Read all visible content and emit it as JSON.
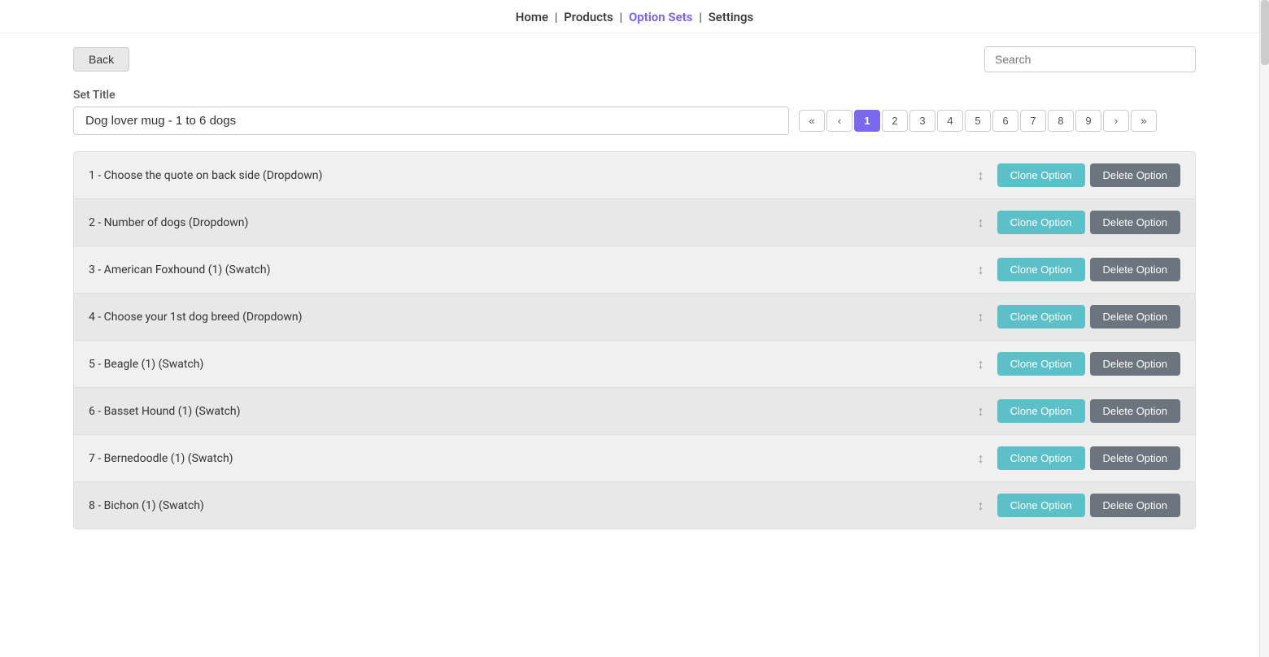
{
  "nav": {
    "home_label": "Home",
    "products_label": "Products",
    "option_sets_label": "Option Sets",
    "settings_label": "Settings",
    "active": "option_sets"
  },
  "toolbar": {
    "back_label": "Back",
    "search_placeholder": "Search"
  },
  "set_title": {
    "label": "Set Title",
    "value": "Dog lover mug - 1 to 6 dogs"
  },
  "pagination": {
    "first": "«",
    "prev": "‹",
    "next": "›",
    "last": "»",
    "pages": [
      "1",
      "2",
      "3",
      "4",
      "5",
      "6",
      "7",
      "8",
      "9"
    ],
    "active_page": "1"
  },
  "options": [
    {
      "id": 1,
      "label": "1 - Choose the quote on back side (Dropdown)"
    },
    {
      "id": 2,
      "label": "2 - Number of dogs (Dropdown)"
    },
    {
      "id": 3,
      "label": "3 - American Foxhound (1) (Swatch)"
    },
    {
      "id": 4,
      "label": "4 - Choose your 1st dog breed (Dropdown)"
    },
    {
      "id": 5,
      "label": "5 - Beagle (1) (Swatch)"
    },
    {
      "id": 6,
      "label": "6 - Basset Hound (1) (Swatch)"
    },
    {
      "id": 7,
      "label": "7 - Bernedoodle (1) (Swatch)"
    },
    {
      "id": 8,
      "label": "8 - Bichon (1) (Swatch)"
    }
  ],
  "buttons": {
    "clone_label": "Clone Option",
    "delete_label": "Delete Option"
  }
}
